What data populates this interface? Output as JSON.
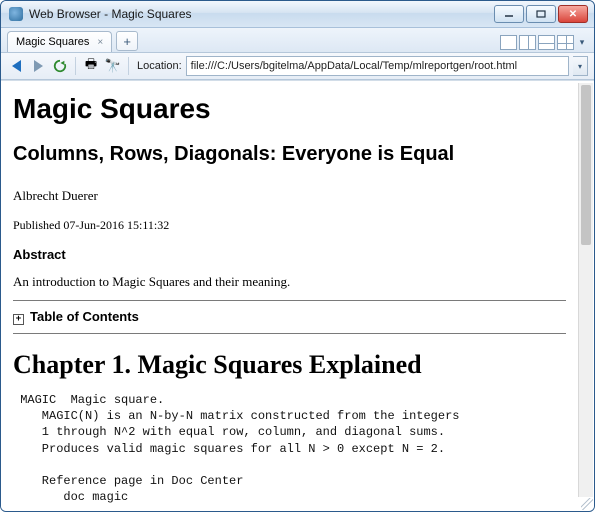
{
  "window": {
    "title": "Web Browser - Magic Squares"
  },
  "tab": {
    "label": "Magic Squares"
  },
  "navbar": {
    "location_label": "Location:",
    "url": "file:///C:/Users/bgitelma/AppData/Local/Temp/mlreportgen/root.html"
  },
  "document": {
    "title": "Magic Squares",
    "subtitle": "Columns, Rows, Diagonals: Everyone is Equal",
    "author": "Albrecht Duerer",
    "published": "Published  07-Jun-2016 15:11:32",
    "abstract_heading": "Abstract",
    "abstract_text": "An introduction to Magic Squares and their meaning.",
    "toc_label": "Table of Contents",
    "chapter_heading": "Chapter 1. Magic Squares Explained",
    "code": " MAGIC  Magic square.\n    MAGIC(N) is an N-by-N matrix constructed from the integers\n    1 through N^2 with equal row, column, and diagonal sums.\n    Produces valid magic squares for all N > 0 except N = 2.\n\n    Reference page in Doc Center\n       doc magic"
  }
}
